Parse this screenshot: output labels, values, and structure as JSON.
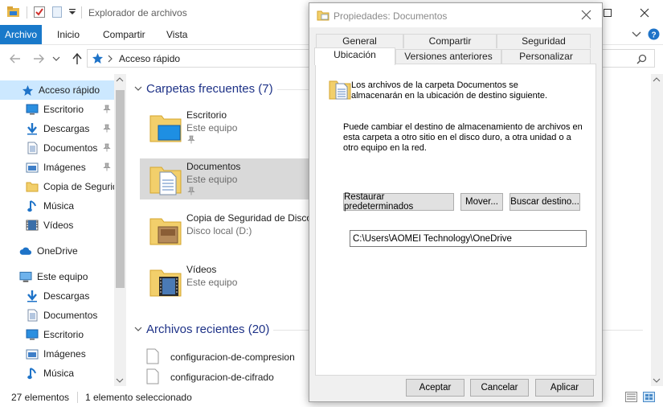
{
  "explorer": {
    "title": "Explorador de archivos",
    "ribbon_tabs": [
      "Archivo",
      "Inicio",
      "Compartir",
      "Vista"
    ],
    "address": "Acceso rápido",
    "nav": {
      "quick_access": "Acceso rápido",
      "items": [
        {
          "label": "Escritorio",
          "icon": "desktop-icon"
        },
        {
          "label": "Descargas",
          "icon": "download-icon"
        },
        {
          "label": "Documentos",
          "icon": "document-icon"
        },
        {
          "label": "Imágenes",
          "icon": "image-icon"
        },
        {
          "label": "Copia de Seguridad",
          "icon": "folder-icon"
        },
        {
          "label": "Música",
          "icon": "music-icon"
        },
        {
          "label": "Vídeos",
          "icon": "video-icon"
        }
      ],
      "onedrive": "OneDrive",
      "this_pc": "Este equipo",
      "pc_items": [
        {
          "label": "Descargas",
          "icon": "download-icon"
        },
        {
          "label": "Documentos",
          "icon": "document-icon"
        },
        {
          "label": "Escritorio",
          "icon": "desktop-icon"
        },
        {
          "label": "Imágenes",
          "icon": "image-icon"
        },
        {
          "label": "Música",
          "icon": "music-icon"
        }
      ]
    },
    "frequent": {
      "header": "Carpetas frecuentes (7)",
      "tiles": [
        {
          "name": "Escritorio",
          "sub": "Este equipo"
        },
        {
          "name": "Documentos",
          "sub": "Este equipo"
        },
        {
          "name": "Copia de Seguridad de Disco",
          "sub": "Disco local (D:)"
        },
        {
          "name": "Vídeos",
          "sub": "Este equipo"
        }
      ]
    },
    "recent": {
      "header": "Archivos recientes (20)",
      "files": [
        "configuracion-de-compresion",
        "configuracion-de-cifrado"
      ]
    },
    "status": {
      "count": "27 elementos",
      "selection": "1 elemento seleccionado"
    }
  },
  "dialog": {
    "title": "Propiedades: Documentos",
    "tabs_row1": [
      "General",
      "Compartir",
      "Seguridad"
    ],
    "tabs_row2": [
      "Ubicación",
      "Versiones anteriores",
      "Personalizar"
    ],
    "active_tab": "Ubicación",
    "info_text": "Los archivos de la carpeta Documentos se almacenarán en la ubicación de destino siguiente.",
    "change_text": "Puede cambiar el destino de almacenamiento de archivos en esta carpeta a otro sitio en el disco duro, a otra unidad o a otro equipo en la red.",
    "path_value": "C:\\Users\\AOMEI Technology\\OneDrive",
    "buttons": {
      "restore": "Restaurar predeterminados",
      "move": "Mover...",
      "find": "Buscar destino...",
      "ok": "Aceptar",
      "cancel": "Cancelar",
      "apply": "Aplicar"
    }
  }
}
